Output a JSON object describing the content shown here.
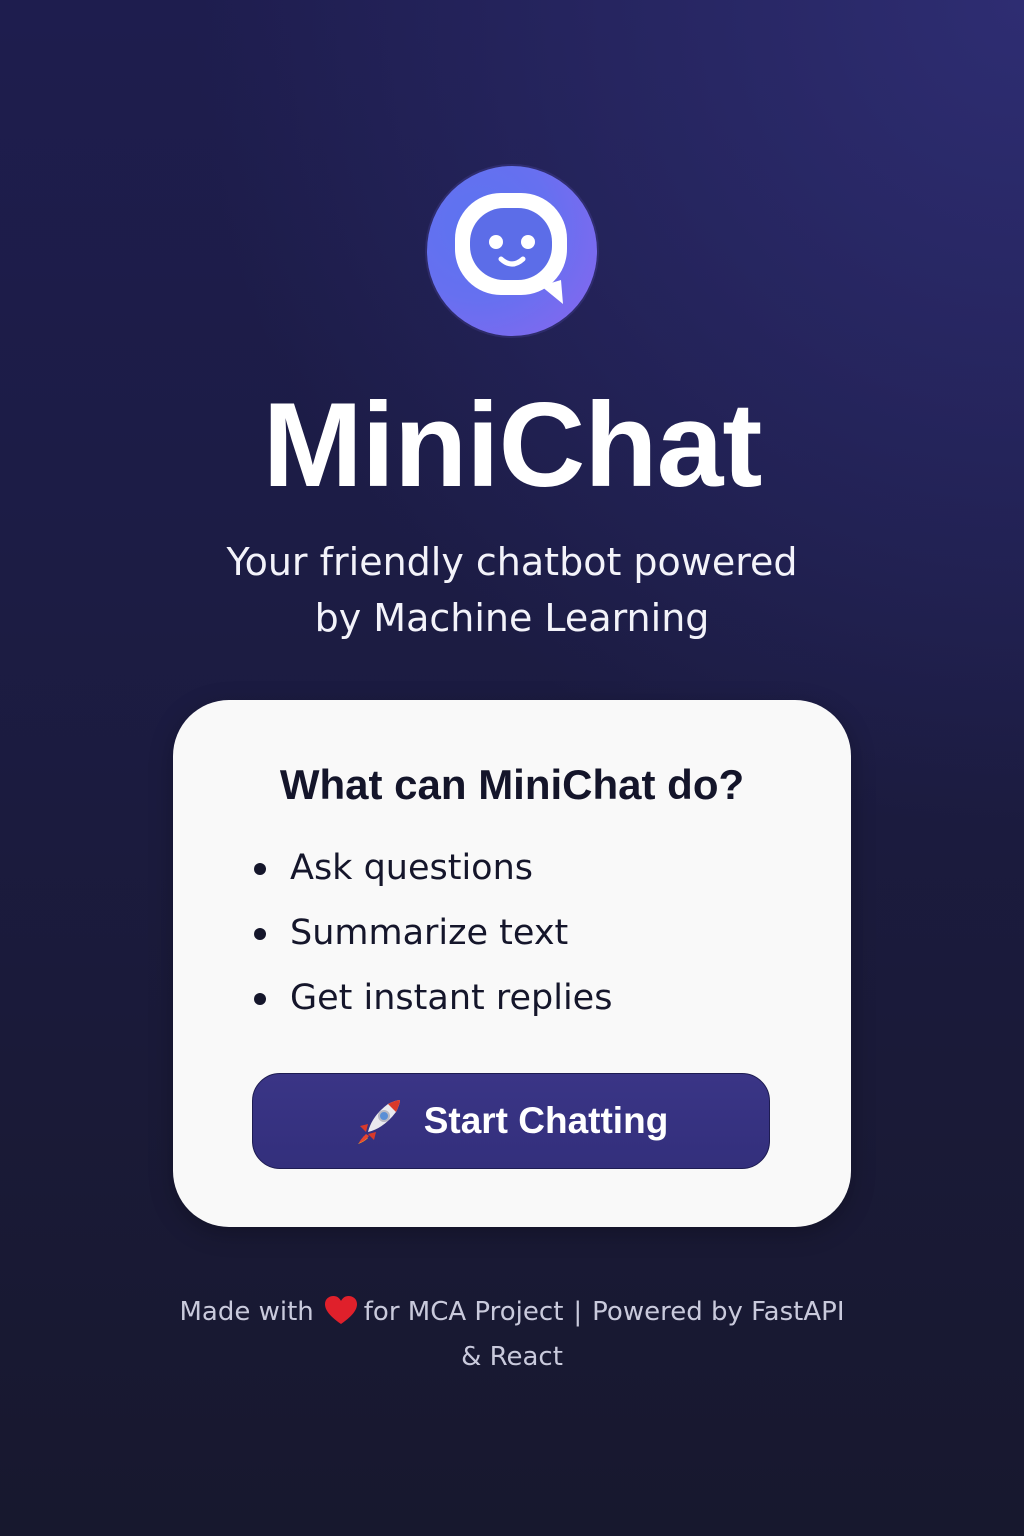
{
  "app": {
    "title": "MiniChat",
    "subtitle_line1": "Your friendly chatbot powered",
    "subtitle_line2": "by Machine Learning"
  },
  "logo": {
    "icon": "chatbot-smiley-icon",
    "accent_start": "#5c73f0",
    "accent_end": "#8a66ee"
  },
  "card": {
    "heading": "What can MiniChat do?",
    "features": [
      {
        "label": "Ask questions"
      },
      {
        "label": "Summarize text"
      },
      {
        "label": "Get instant replies"
      }
    ],
    "button": {
      "label": "Start Chatting",
      "icon": "rocket-icon",
      "color": "#362f80"
    }
  },
  "footer": {
    "made_with": "Made with",
    "heart_icon": "heart-icon",
    "for_project": "for MCA Project",
    "separator": "|",
    "powered_by": "Powered by FastAPI",
    "line2": "& React"
  }
}
